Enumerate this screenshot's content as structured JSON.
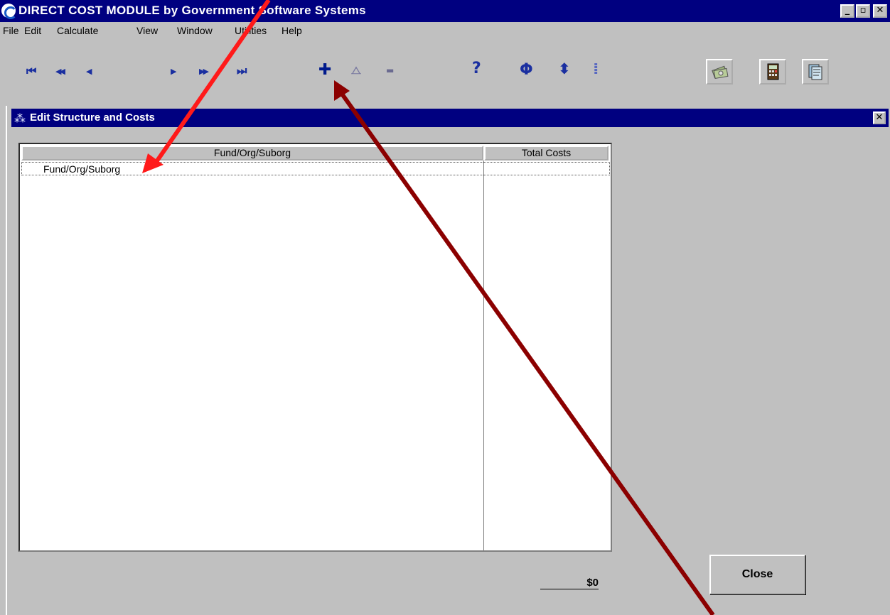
{
  "app": {
    "title": "DIRECT COST MODULE by Government Software Systems",
    "minimize_glyph": "_",
    "maximize_glyph": "▫",
    "close_glyph": "✕"
  },
  "menu": [
    "File",
    "Edit",
    "Calculate",
    "View",
    "Window",
    "Utilities",
    "Help"
  ],
  "toolbar": {
    "icons": [
      "first-record-icon",
      "previous-page-icon",
      "previous-record-icon",
      "next-record-icon",
      "next-page-icon",
      "last-record-icon",
      "add-icon",
      "insert-icon",
      "delete-icon",
      "help-icon",
      "refresh-icon",
      "expand-icon",
      "collapse-icon",
      "money-icon",
      "calculator-icon",
      "reports-icon"
    ],
    "glyphs": {
      "first": "⏮",
      "prev_page": "◀◀",
      "prev": "◀",
      "next": "▶",
      "next_page": "▶▶",
      "last": "⏭",
      "add": "✚",
      "insert": "⧍",
      "delete": "▬",
      "help": "?",
      "refresh": "Φ",
      "expand": "⬍",
      "collapse": "⁞"
    }
  },
  "child_window": {
    "title": "Edit Structure and Costs",
    "icon_glyph": "⁂",
    "close_glyph": "✕"
  },
  "grid": {
    "columns": [
      "Fund/Org/Suborg",
      "Total Costs"
    ],
    "rows": [
      {
        "name": "Fund/Org/Suborg",
        "total": ""
      }
    ]
  },
  "footer": {
    "total": "$0",
    "close_label": "Close"
  },
  "colors": {
    "titlebar": "#000080",
    "face": "#c0c0c0",
    "arrow_red": "#ff1a1a",
    "arrow_dark": "#8b0000"
  }
}
